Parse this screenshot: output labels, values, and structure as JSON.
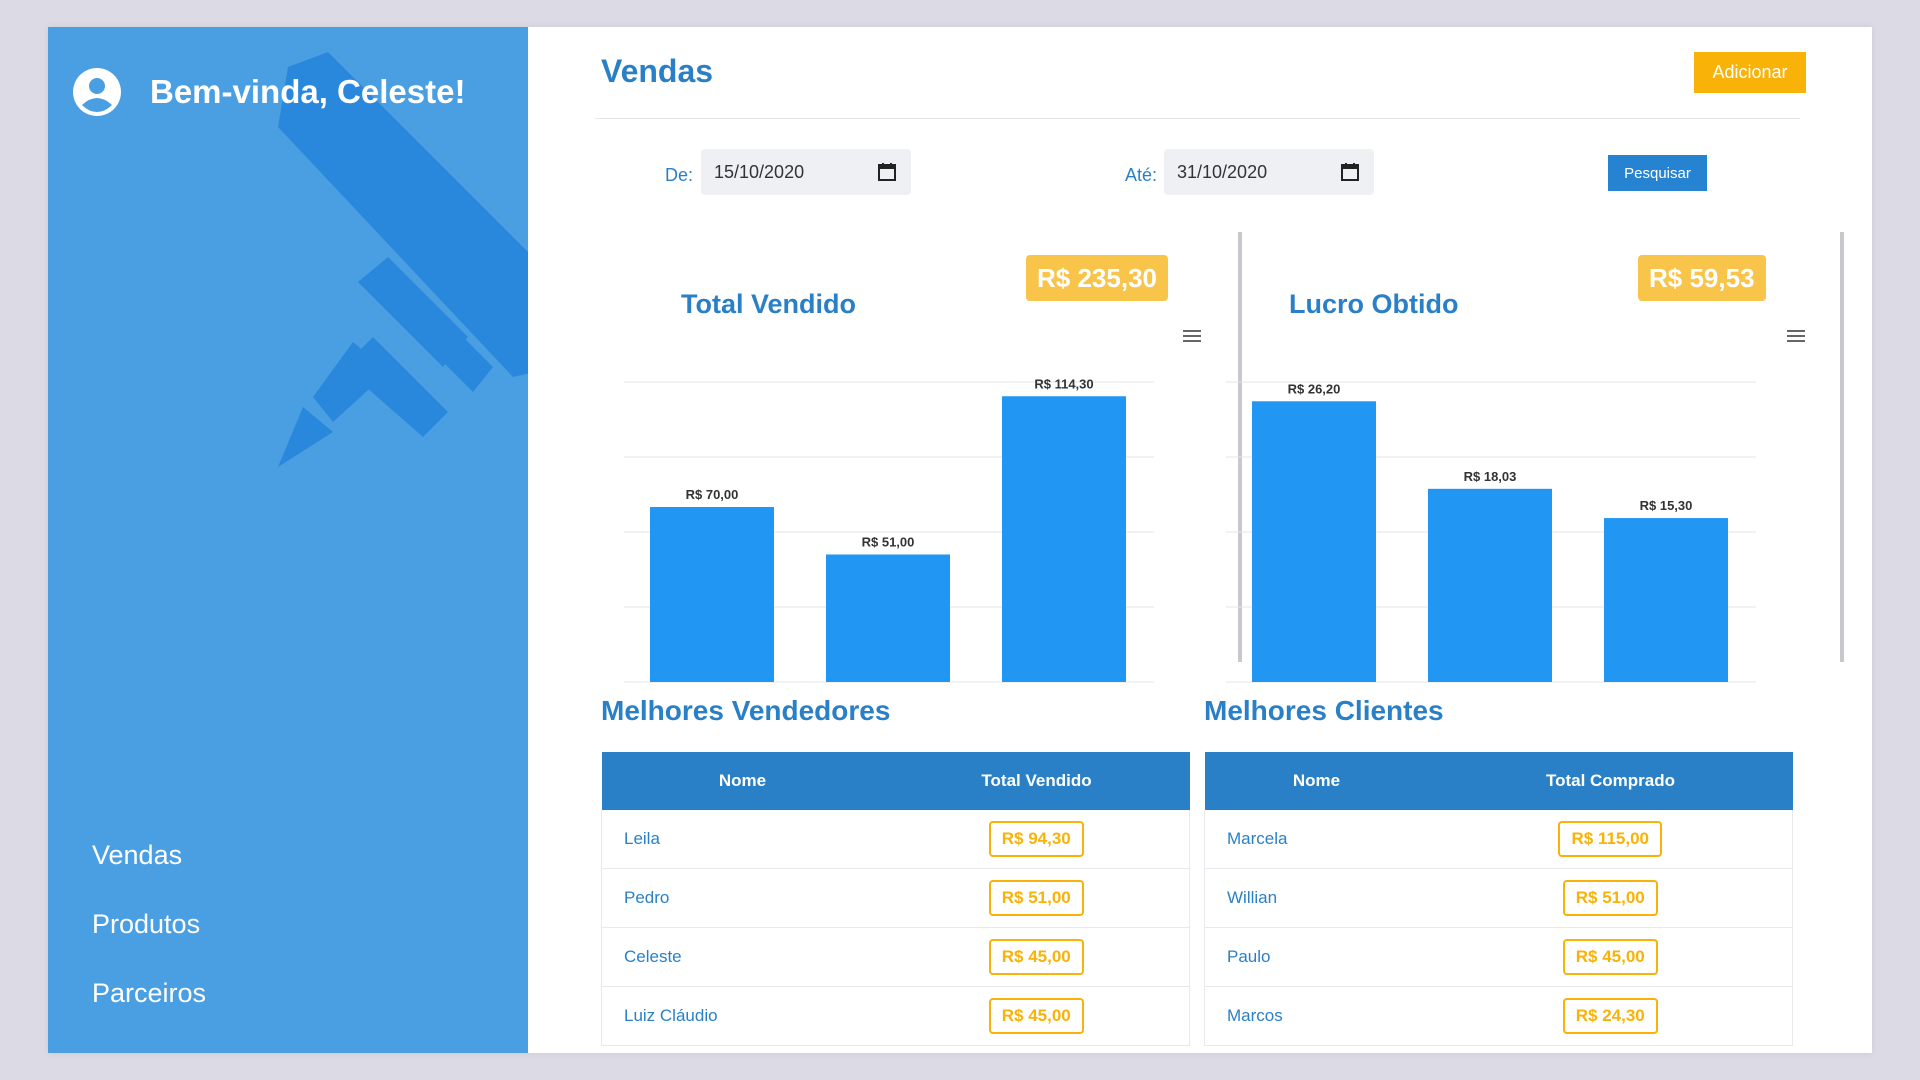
{
  "sidebar": {
    "welcome": "Bem-vinda, Celeste!",
    "nav": [
      "Vendas",
      "Produtos",
      "Parceiros"
    ],
    "icons": {
      "avatar": "user-circle-icon",
      "background": "pencil-icon"
    }
  },
  "header": {
    "title": "Vendas",
    "add_label": "Adicionar"
  },
  "filters": {
    "from_label": "De:",
    "from_value": "15/10/2020",
    "to_label": "Até:",
    "to_value": "31/10/2020",
    "search_label": "Pesquisar"
  },
  "summary": {
    "sold_title": "Total Vendido",
    "sold_total": "R$ 235,30",
    "profit_title": "Lucro Obtido",
    "profit_total": "R$ 59,53"
  },
  "chart_data": [
    {
      "type": "bar",
      "title": "Total Vendido",
      "values": [
        70.0,
        51.0,
        114.3
      ],
      "labels": [
        "R$ 70,00",
        "R$ 51,00",
        "R$ 114,30"
      ],
      "ylim": [
        0,
        120
      ],
      "grid": true,
      "color": "#2196f3"
    },
    {
      "type": "bar",
      "title": "Lucro Obtido",
      "values": [
        26.2,
        18.03,
        15.3
      ],
      "labels": [
        "R$ 26,20",
        "R$ 18,03",
        "R$ 15,30"
      ],
      "ylim": [
        0,
        28
      ],
      "grid": true,
      "color": "#2196f3"
    }
  ],
  "sellers": {
    "title": "Melhores Vendedores",
    "columns": [
      "Nome",
      "Total Vendido"
    ],
    "rows": [
      [
        "Leila",
        "R$ 94,30"
      ],
      [
        "Pedro",
        "R$ 51,00"
      ],
      [
        "Celeste",
        "R$ 45,00"
      ],
      [
        "Luiz Cláudio",
        "R$ 45,00"
      ]
    ]
  },
  "clients": {
    "title": "Melhores Clientes",
    "columns": [
      "Nome",
      "Total Comprado"
    ],
    "rows": [
      [
        "Marcela",
        "R$ 115,00"
      ],
      [
        "Willian",
        "R$ 51,00"
      ],
      [
        "Paulo",
        "R$ 45,00"
      ],
      [
        "Marcos",
        "R$ 24,30"
      ]
    ]
  },
  "colors": {
    "primary": "#2a80c6",
    "sidebar": "#4a9fe3",
    "accent": "#f9b208",
    "bar": "#2196f3"
  }
}
